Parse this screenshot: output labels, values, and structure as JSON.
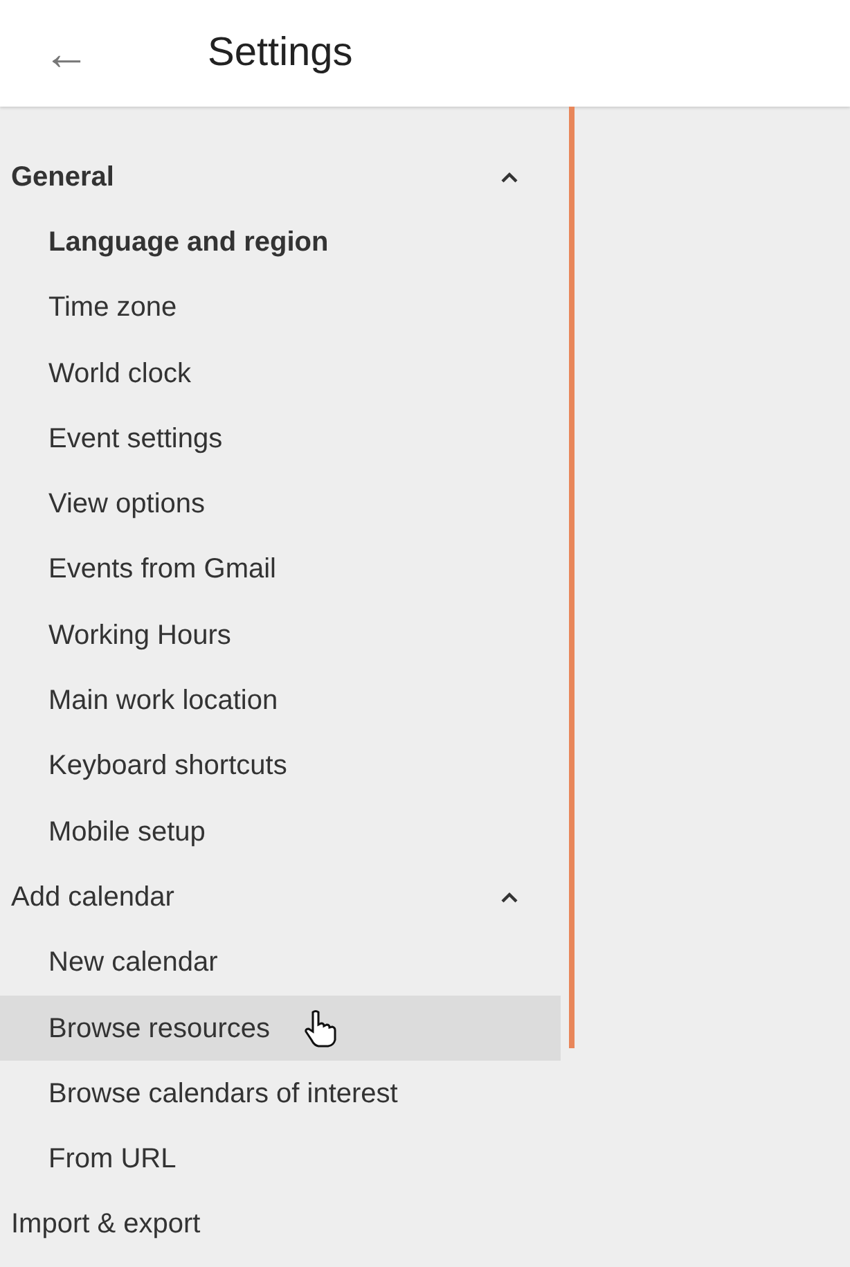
{
  "header": {
    "back_icon": "←",
    "title": "Settings"
  },
  "sections": [
    {
      "label": "General",
      "selected": true,
      "expanded": true,
      "items": [
        {
          "label": "Language and region",
          "selected": true,
          "hovered": false
        },
        {
          "label": "Time zone",
          "selected": false,
          "hovered": false
        },
        {
          "label": "World clock",
          "selected": false,
          "hovered": false
        },
        {
          "label": "Event settings",
          "selected": false,
          "hovered": false
        },
        {
          "label": "View options",
          "selected": false,
          "hovered": false
        },
        {
          "label": "Events from Gmail",
          "selected": false,
          "hovered": false
        },
        {
          "label": "Working Hours",
          "selected": false,
          "hovered": false
        },
        {
          "label": "Main work location",
          "selected": false,
          "hovered": false
        },
        {
          "label": "Keyboard shortcuts",
          "selected": false,
          "hovered": false
        },
        {
          "label": "Mobile setup",
          "selected": false,
          "hovered": false
        }
      ]
    },
    {
      "label": "Add calendar",
      "selected": false,
      "expanded": true,
      "items": [
        {
          "label": "New calendar",
          "selected": false,
          "hovered": false
        },
        {
          "label": "Browse resources",
          "selected": false,
          "hovered": true
        },
        {
          "label": "Browse calendars of interest",
          "selected": false,
          "hovered": false
        },
        {
          "label": "From URL",
          "selected": false,
          "hovered": false
        }
      ]
    },
    {
      "label": "Import & export",
      "selected": false
    }
  ]
}
